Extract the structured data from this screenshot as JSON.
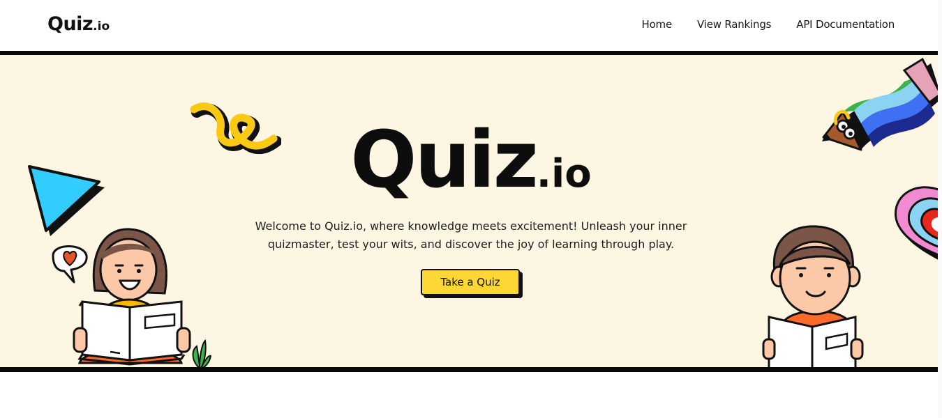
{
  "header": {
    "logo_main": "Quiz",
    "logo_suffix": ".io",
    "nav": [
      {
        "label": "Home"
      },
      {
        "label": "View Rankings"
      },
      {
        "label": "API Documentation"
      }
    ]
  },
  "hero": {
    "title_main": "Quiz",
    "title_suffix": ".io",
    "tagline": "Welcome to Quiz.io, where knowledge meets excitement! Unleash your inner quizmaster, test your wits, and discover the joy of learning through play.",
    "cta_label": "Take a Quiz"
  },
  "colors": {
    "hero_background": "#fdf6e3",
    "cta_background": "#fdd835",
    "border": "#0a0a0a"
  }
}
